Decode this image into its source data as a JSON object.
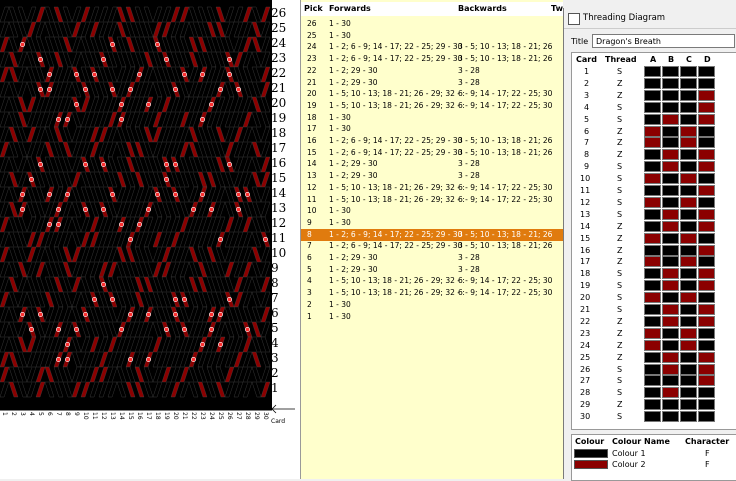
{
  "pattern": {
    "row_labels": [
      "26",
      "25",
      "24",
      "23",
      "22",
      "21",
      "20",
      "19",
      "18",
      "17",
      "16",
      "15",
      "14",
      "13",
      "12",
      "11",
      "10",
      "9",
      "8",
      "7",
      "6",
      "5",
      "4",
      "3",
      "2",
      "1"
    ],
    "card_numbers": [
      "1",
      "2",
      "3",
      "4",
      "5",
      "6",
      "7",
      "8",
      "9",
      "10",
      "11",
      "12",
      "13",
      "14",
      "15",
      "16",
      "17",
      "18",
      "19",
      "20",
      "21",
      "22",
      "23",
      "24",
      "25",
      "26",
      "27",
      "28",
      "29",
      "30"
    ],
    "card_label": "Card",
    "colors": {
      "dark": "#000000",
      "red": "#8b0000",
      "dot": "#ff3030"
    }
  },
  "picks": {
    "headers": {
      "pick": "Pick",
      "forwards": "Forwards",
      "backwards": "Backwards",
      "twist": "Twi"
    },
    "rows": [
      {
        "pick": "26",
        "fwd": "1 - 30",
        "bwd": ""
      },
      {
        "pick": "25",
        "fwd": "1 - 30",
        "bwd": ""
      },
      {
        "pick": "24",
        "fwd": "1 - 2; 6 - 9; 14 - 17; 22 - 25; 29 - 30",
        "bwd": "3 - 5; 10 - 13; 18 - 21; 26"
      },
      {
        "pick": "23",
        "fwd": "1 - 2; 6 - 9; 14 - 17; 22 - 25; 29 - 30",
        "bwd": "3 - 5; 10 - 13; 18 - 21; 26"
      },
      {
        "pick": "22",
        "fwd": "1 - 2; 29 - 30",
        "bwd": "3 - 28"
      },
      {
        "pick": "21",
        "fwd": "1 - 2; 29 - 30",
        "bwd": "3 - 28"
      },
      {
        "pick": "20",
        "fwd": "1 - 5; 10 - 13; 18 - 21; 26 - 29; 32 - :",
        "bwd": "6 - 9; 14 - 17; 22 - 25; 30"
      },
      {
        "pick": "19",
        "fwd": "1 - 5; 10 - 13; 18 - 21; 26 - 29; 32 - :",
        "bwd": "6 - 9; 14 - 17; 22 - 25; 30"
      },
      {
        "pick": "18",
        "fwd": "1 - 30",
        "bwd": ""
      },
      {
        "pick": "17",
        "fwd": "1 - 30",
        "bwd": ""
      },
      {
        "pick": "16",
        "fwd": "1 - 2; 6 - 9; 14 - 17; 22 - 25; 29 - 30",
        "bwd": "3 - 5; 10 - 13; 18 - 21; 26"
      },
      {
        "pick": "15",
        "fwd": "1 - 2; 6 - 9; 14 - 17; 22 - 25; 29 - 30",
        "bwd": "3 - 5; 10 - 13; 18 - 21; 26"
      },
      {
        "pick": "14",
        "fwd": "1 - 2; 29 - 30",
        "bwd": "3 - 28"
      },
      {
        "pick": "13",
        "fwd": "1 - 2; 29 - 30",
        "bwd": "3 - 28"
      },
      {
        "pick": "12",
        "fwd": "1 - 5; 10 - 13; 18 - 21; 26 - 29; 32 - :",
        "bwd": "6 - 9; 14 - 17; 22 - 25; 30"
      },
      {
        "pick": "11",
        "fwd": "1 - 5; 10 - 13; 18 - 21; 26 - 29; 32 - :",
        "bwd": "6 - 9; 14 - 17; 22 - 25; 30"
      },
      {
        "pick": "10",
        "fwd": "1 - 30",
        "bwd": ""
      },
      {
        "pick": "9",
        "fwd": "1 - 30",
        "bwd": ""
      },
      {
        "pick": "8",
        "fwd": "1 - 2; 6 - 9; 14 - 17; 22 - 25; 29 - 30",
        "bwd": "3 - 5; 10 - 13; 18 - 21; 26"
      },
      {
        "pick": "7",
        "fwd": "1 - 2; 6 - 9; 14 - 17; 22 - 25; 29 - 30",
        "bwd": "3 - 5; 10 - 13; 18 - 21; 26"
      },
      {
        "pick": "6",
        "fwd": "1 - 2; 29 - 30",
        "bwd": "3 - 28"
      },
      {
        "pick": "5",
        "fwd": "1 - 2; 29 - 30",
        "bwd": "3 - 28"
      },
      {
        "pick": "4",
        "fwd": "1 - 5; 10 - 13; 18 - 21; 26 - 29; 32 - :",
        "bwd": "6 - 9; 14 - 17; 22 - 25; 30"
      },
      {
        "pick": "3",
        "fwd": "1 - 5; 10 - 13; 18 - 21; 26 - 29; 32 - :",
        "bwd": "6 - 9; 14 - 17; 22 - 25; 30"
      },
      {
        "pick": "2",
        "fwd": "1 - 30",
        "bwd": ""
      },
      {
        "pick": "1",
        "fwd": "1 - 30",
        "bwd": ""
      }
    ],
    "selected_pick": "8"
  },
  "threading": {
    "window_title": "Threading Diagram",
    "title_label": "Title",
    "title_value": "Dragon's Breath",
    "headers": {
      "card": "Card",
      "thread": "Thread",
      "holes": [
        "A",
        "B",
        "C",
        "D"
      ]
    },
    "cards": [
      {
        "card": "1",
        "thread": "S",
        "holes": [
          0,
          0,
          0,
          0
        ]
      },
      {
        "card": "2",
        "thread": "Z",
        "holes": [
          0,
          0,
          0,
          0
        ]
      },
      {
        "card": "3",
        "thread": "Z",
        "holes": [
          0,
          0,
          0,
          1
        ]
      },
      {
        "card": "4",
        "thread": "S",
        "holes": [
          0,
          0,
          0,
          1
        ]
      },
      {
        "card": "5",
        "thread": "S",
        "holes": [
          0,
          1,
          0,
          1
        ]
      },
      {
        "card": "6",
        "thread": "Z",
        "holes": [
          1,
          0,
          1,
          0
        ]
      },
      {
        "card": "7",
        "thread": "Z",
        "holes": [
          1,
          0,
          1,
          0
        ]
      },
      {
        "card": "8",
        "thread": "Z",
        "holes": [
          0,
          1,
          0,
          1
        ]
      },
      {
        "card": "9",
        "thread": "S",
        "holes": [
          0,
          1,
          0,
          1
        ]
      },
      {
        "card": "10",
        "thread": "S",
        "holes": [
          1,
          0,
          1,
          0
        ]
      },
      {
        "card": "11",
        "thread": "S",
        "holes": [
          0,
          0,
          0,
          1
        ]
      },
      {
        "card": "12",
        "thread": "S",
        "holes": [
          1,
          0,
          1,
          0
        ]
      },
      {
        "card": "13",
        "thread": "S",
        "holes": [
          0,
          1,
          0,
          1
        ]
      },
      {
        "card": "14",
        "thread": "Z",
        "holes": [
          0,
          1,
          0,
          1
        ]
      },
      {
        "card": "15",
        "thread": "Z",
        "holes": [
          1,
          0,
          1,
          0
        ]
      },
      {
        "card": "16",
        "thread": "Z",
        "holes": [
          0,
          0,
          0,
          1
        ]
      },
      {
        "card": "17",
        "thread": "Z",
        "holes": [
          1,
          0,
          1,
          0
        ]
      },
      {
        "card": "18",
        "thread": "S",
        "holes": [
          0,
          1,
          0,
          1
        ]
      },
      {
        "card": "19",
        "thread": "S",
        "holes": [
          0,
          1,
          0,
          1
        ]
      },
      {
        "card": "20",
        "thread": "S",
        "holes": [
          1,
          0,
          1,
          0
        ]
      },
      {
        "card": "21",
        "thread": "S",
        "holes": [
          0,
          1,
          0,
          1
        ]
      },
      {
        "card": "22",
        "thread": "Z",
        "holes": [
          0,
          1,
          0,
          1
        ]
      },
      {
        "card": "23",
        "thread": "Z",
        "holes": [
          1,
          0,
          1,
          0
        ]
      },
      {
        "card": "24",
        "thread": "Z",
        "holes": [
          1,
          0,
          1,
          0
        ]
      },
      {
        "card": "25",
        "thread": "Z",
        "holes": [
          0,
          1,
          0,
          1
        ]
      },
      {
        "card": "26",
        "thread": "S",
        "holes": [
          0,
          1,
          0,
          1
        ]
      },
      {
        "card": "27",
        "thread": "S",
        "holes": [
          0,
          0,
          0,
          1
        ]
      },
      {
        "card": "28",
        "thread": "S",
        "holes": [
          0,
          1,
          0,
          0
        ]
      },
      {
        "card": "29",
        "thread": "Z",
        "holes": [
          0,
          0,
          0,
          0
        ]
      },
      {
        "card": "30",
        "thread": "S",
        "holes": [
          0,
          0,
          0,
          0
        ]
      }
    ],
    "legend": {
      "headers": {
        "colour": "Colour",
        "name": "Colour Name",
        "character": "Character"
      },
      "rows": [
        {
          "name": "Colour 1",
          "character": "F",
          "color": "#000000"
        },
        {
          "name": "Colour 2",
          "character": "F",
          "color": "#8b0000"
        }
      ]
    }
  }
}
